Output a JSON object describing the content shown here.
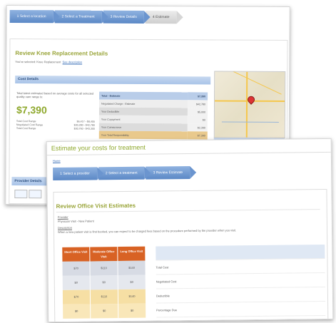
{
  "back": {
    "steps": [
      {
        "label": "1 Select a location",
        "active": true
      },
      {
        "label": "2 Select a Treatment",
        "active": true
      },
      {
        "label": "3 Review Details",
        "active": true
      },
      {
        "label": "4 Estimate",
        "active": false
      }
    ],
    "title": "Review Knee Replacement Details",
    "subtitle": "You've selected: Knee Replacement",
    "subtitle_link": "See description",
    "cost_header": "Cost Details",
    "cost_intro": "Total latest estimated based on average costs for all selected quality care range is:",
    "total_price": "$7,390",
    "ranges": [
      {
        "label": "Total Cost Range",
        "low": "$6,417",
        "high": "$8,455"
      },
      {
        "label": "Negotiated Cost Range",
        "low": "$30,280",
        "high": "$42,780"
      },
      {
        "label": "Total Cost Range",
        "low": "$30,760",
        "high": "$43,300"
      }
    ],
    "cost_table": {
      "header": {
        "label": "Total - Estimate",
        "value": "$7,390"
      },
      "rows": [
        {
          "label": "Negotiated Charge - Estimate",
          "value": "$42,780",
          "style": "alt"
        },
        {
          "label": "Your Deductible",
          "value": "$5,000",
          "style": ""
        },
        {
          "label": "Your Copayment",
          "value": "$0",
          "style": "alt"
        },
        {
          "label": "Your Coinsurance",
          "value": "$2,390",
          "style": ""
        },
        {
          "label": "Your Total Responsibility",
          "value": "$7,390",
          "style": "hl"
        }
      ]
    },
    "providers_header": "Provider Details"
  },
  "front": {
    "header": "Estimate your costs for treatment",
    "back_link": "Home",
    "steps": [
      {
        "label": "1 Select a provider",
        "active": true
      },
      {
        "label": "2 Select a treatment",
        "active": true
      },
      {
        "label": "3 Review Estimate",
        "active": true
      }
    ],
    "title": "Review Office Visit Estimates",
    "provider_label": "Provider",
    "provider_value": "Physician Visit - New Patient",
    "description_label": "Description",
    "description_text": "When a new patient visit is first booked, you can expect to be charged fees based on the procedure performed by the provider when you visit.",
    "columns": [
      "Short Office Visit",
      "Moderate Office Visit",
      "Long Office Visit"
    ],
    "rows": [
      {
        "values": [
          "$70",
          "$110",
          "$140"
        ],
        "label": "Total Cost"
      },
      {
        "values": [
          "$0",
          "$0",
          "$0"
        ],
        "label": "Negotiated Cost"
      },
      {
        "values": [
          "$70",
          "$110",
          "$140"
        ],
        "label": "Deductible"
      },
      {
        "values": [
          "$0",
          "$0",
          "$0"
        ],
        "label": "Percentage Due"
      }
    ]
  }
}
